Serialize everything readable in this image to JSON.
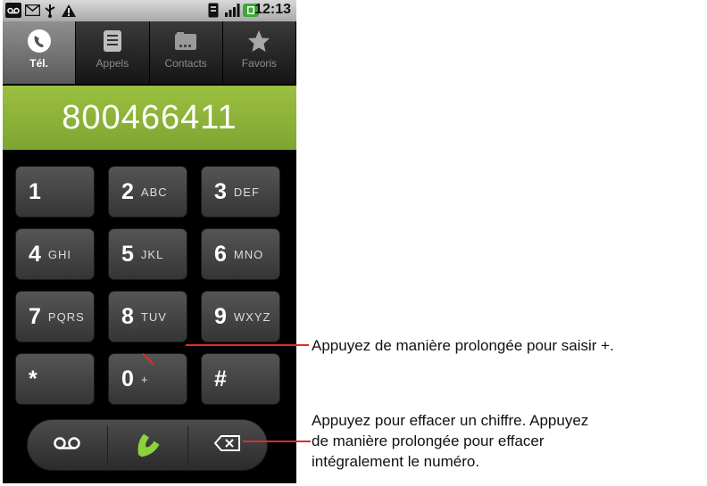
{
  "status_bar": {
    "time": "12:13"
  },
  "tabs": [
    {
      "label": "Tél.",
      "icon": "phone-icon",
      "active": true
    },
    {
      "label": "Appels",
      "icon": "call-log-icon",
      "active": false
    },
    {
      "label": "Contacts",
      "icon": "contacts-icon",
      "active": false
    },
    {
      "label": "Favoris",
      "icon": "star-icon",
      "active": false
    }
  ],
  "number_display": {
    "value": "800466411"
  },
  "keypad": {
    "keys": [
      {
        "digit": "1",
        "letters": ""
      },
      {
        "digit": "2",
        "letters": "ABC"
      },
      {
        "digit": "3",
        "letters": "DEF"
      },
      {
        "digit": "4",
        "letters": "GHI"
      },
      {
        "digit": "5",
        "letters": "JKL"
      },
      {
        "digit": "6",
        "letters": "MNO"
      },
      {
        "digit": "7",
        "letters": "PQRS"
      },
      {
        "digit": "8",
        "letters": "TUV"
      },
      {
        "digit": "9",
        "letters": "WXYZ"
      },
      {
        "digit": "*",
        "letters": ""
      },
      {
        "digit": "0",
        "letters": "+"
      },
      {
        "digit": "#",
        "letters": ""
      }
    ]
  },
  "action_bar": {
    "voicemail_icon": "voicemail-icon",
    "call_icon": "call-icon",
    "delete_icon": "backspace-icon"
  },
  "callouts": {
    "plus": "Appuyez de manière prolongée pour saisir +.",
    "delete_line1": "Appuyez pour effacer un chiffre. Appuyez",
    "delete_line2": "de manière prolongée pour effacer",
    "delete_line3": "intégralement le numéro."
  },
  "colors": {
    "callout_line": "#e02a2a",
    "number_field": "#8fb53a",
    "call_green": "#8cd23c"
  }
}
